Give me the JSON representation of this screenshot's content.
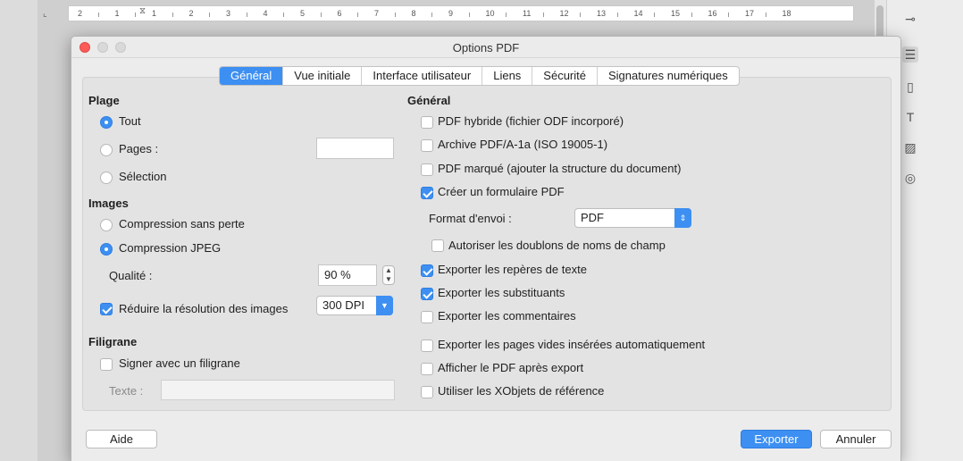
{
  "ruler": {
    "numbers": [
      "2",
      "1",
      "1",
      "2",
      "3",
      "4",
      "5",
      "6",
      "7",
      "8",
      "9",
      "10",
      "11",
      "12",
      "13",
      "14",
      "15",
      "16",
      "17",
      "18"
    ]
  },
  "dialog": {
    "title": "Options PDF",
    "tabs": [
      {
        "label": "Général",
        "active": true
      },
      {
        "label": "Vue initiale"
      },
      {
        "label": "Interface utilisateur"
      },
      {
        "label": "Liens"
      },
      {
        "label": "Sécurité"
      },
      {
        "label": "Signatures numériques"
      }
    ]
  },
  "left": {
    "range": {
      "heading": "Plage",
      "all": "Tout",
      "pages": "Pages :",
      "selection": "Sélection",
      "pages_value": ""
    },
    "images": {
      "heading": "Images",
      "lossless": "Compression sans perte",
      "jpeg": "Compression JPEG",
      "quality_label": "Qualité :",
      "quality_value": "90 %",
      "reduce_label": "Réduire la résolution des images",
      "dpi_value": "300 DPI"
    },
    "watermark": {
      "heading": "Filigrane",
      "sign_label": "Signer avec un filigrane",
      "text_label": "Texte :",
      "text_value": ""
    }
  },
  "right": {
    "heading": "Général",
    "hybrid": "PDF hybride (fichier ODF incorporé)",
    "archive": "Archive PDF/A-1a (ISO 19005-1)",
    "tagged": "PDF marqué (ajouter la structure du document)",
    "form": "Créer un formulaire PDF",
    "submit_label": "Format d'envoi :",
    "submit_value": "PDF",
    "duplicates": "Autoriser les doublons de noms de champ",
    "bookmarks": "Exporter les repères de texte",
    "placeholders": "Exporter les substituants",
    "comments": "Exporter les commentaires",
    "blank_pages": "Exporter les pages vides insérées automatiquement",
    "view_after": "Afficher le PDF après export",
    "xobjects": "Utiliser les XObjets de référence"
  },
  "buttons": {
    "help": "Aide",
    "export": "Exporter",
    "cancel": "Annuler"
  },
  "colors": {
    "accent": "#3d8ff2",
    "close": "#fc5b57"
  }
}
